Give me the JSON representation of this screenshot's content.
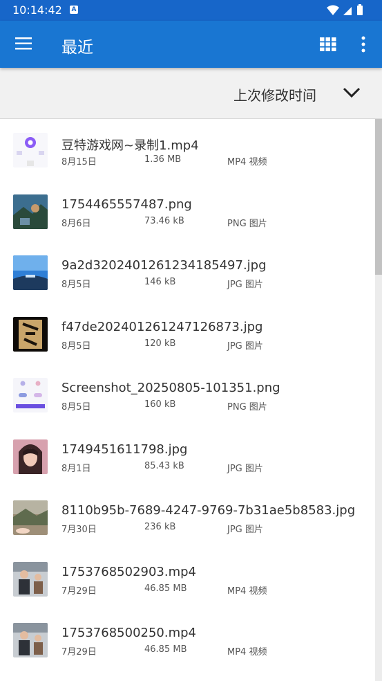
{
  "status_bar": {
    "time": "10:14:42",
    "badge": "A"
  },
  "app_bar": {
    "title": "最近"
  },
  "sort": {
    "label": "上次修改时间"
  },
  "files": [
    {
      "name": "豆特游戏网~录制1.mp4",
      "date": "8月15日",
      "size": "1.36 MB",
      "type": "MP4 视频"
    },
    {
      "name": "1754465557487.png",
      "date": "8月6日",
      "size": "73.46 kB",
      "type": "PNG 图片"
    },
    {
      "name": "9a2d3202401261234185497.jpg",
      "date": "8月5日",
      "size": "146 kB",
      "type": "JPG 图片"
    },
    {
      "name": "f47de202401261247126873.jpg",
      "date": "8月5日",
      "size": "120 kB",
      "type": "JPG 图片"
    },
    {
      "name": "Screenshot_20250805-101351.png",
      "date": "8月5日",
      "size": "160 kB",
      "type": "PNG 图片"
    },
    {
      "name": "1749451611798.jpg",
      "date": "8月1日",
      "size": "85.43 kB",
      "type": "JPG 图片"
    },
    {
      "name": "8110b95b-7689-4247-9769-7b31ae5b8583.jpg",
      "date": "7月30日",
      "size": "236 kB",
      "type": "JPG 图片"
    },
    {
      "name": "1753768502903.mp4",
      "date": "7月29日",
      "size": "46.85 MB",
      "type": "MP4 视频"
    },
    {
      "name": "1753768500250.mp4",
      "date": "7月29日",
      "size": "46.85 MB",
      "type": "MP4 视频"
    }
  ]
}
